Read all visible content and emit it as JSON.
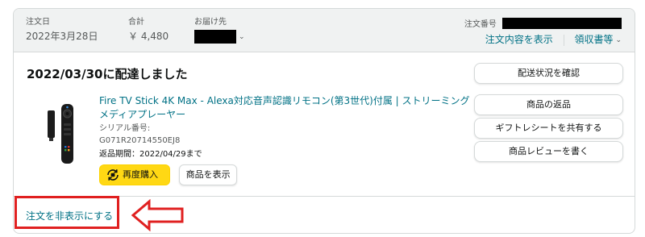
{
  "header": {
    "order_date_label": "注文日",
    "order_date_value": "2022年3月28日",
    "total_label": "合計",
    "total_value": "￥ 4,480",
    "ship_to_label": "お届け先",
    "order_number_label": "注文番号",
    "order_details_link": "注文内容を表示",
    "invoice_link": "領収書等"
  },
  "delivery": {
    "status": "2022/03/30に配達しました"
  },
  "item": {
    "title": "Fire TV Stick 4K Max - Alexa対応音声認識リモコン(第3世代)付属 | ストリーミングメディアプレーヤー",
    "serial_label": "シリアル番号:",
    "serial_value": "G071R20714550EJ8",
    "return_period": "返品期間：2022/04/29まで",
    "buy_again_label": "再度購入",
    "view_item_label": "商品を表示"
  },
  "side_actions": {
    "track_package": "配送状況を確認",
    "return_items": "商品の返品",
    "share_gift_receipt": "ギフトレシートを共有する",
    "write_review": "商品レビューを書く"
  },
  "footer": {
    "hide_order": "注文を非表示にする"
  },
  "colors": {
    "link": "#007185",
    "header_bg": "#f0f2f2",
    "border": "#d5d9d9",
    "buy_again_bg": "#ffd814",
    "annotation": "#e02020"
  },
  "icons": {
    "buy_again": "reorder-icon",
    "dropdown": "chevron-down-icon",
    "annotation": "arrow-left-icon"
  }
}
